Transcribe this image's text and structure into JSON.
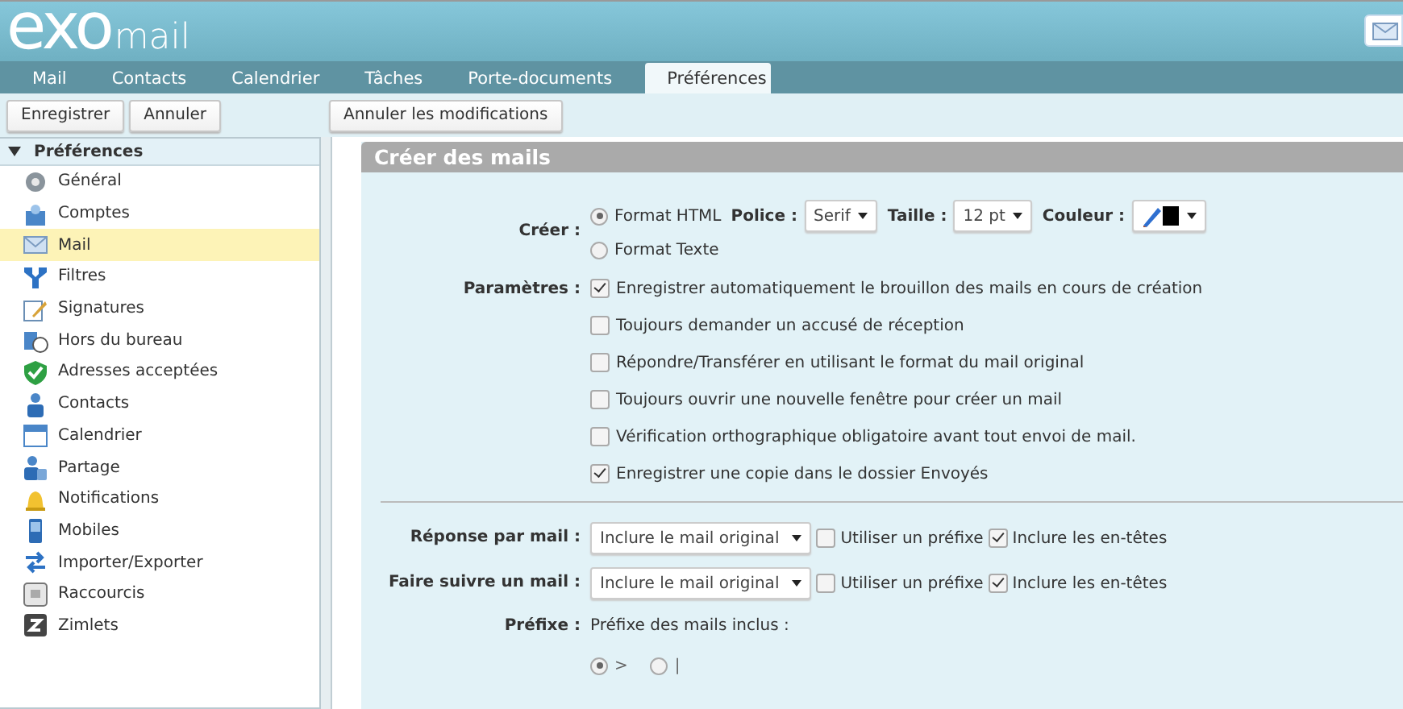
{
  "logo": {
    "brand": "exo",
    "product": "mail"
  },
  "tabs": [
    {
      "label": "Mail",
      "selected": false
    },
    {
      "label": "Contacts",
      "selected": false
    },
    {
      "label": "Calendrier",
      "selected": false
    },
    {
      "label": "Tâches",
      "selected": false
    },
    {
      "label": "Porte-documents",
      "selected": false
    },
    {
      "label": "Préférences",
      "selected": true
    }
  ],
  "toolbar": {
    "left": [
      "Enregistrer",
      "Annuler"
    ],
    "right": [
      "Annuler les modifications"
    ]
  },
  "sidebar": {
    "title": "Préférences",
    "expanded": true,
    "items": [
      {
        "label": "Général",
        "selected": false
      },
      {
        "label": "Comptes",
        "selected": false
      },
      {
        "label": "Mail",
        "selected": true
      },
      {
        "label": "Filtres",
        "selected": false
      },
      {
        "label": "Signatures",
        "selected": false
      },
      {
        "label": "Hors du bureau",
        "selected": false
      },
      {
        "label": "Adresses acceptées",
        "selected": false
      },
      {
        "label": "Contacts",
        "selected": false
      },
      {
        "label": "Calendrier",
        "selected": false
      },
      {
        "label": "Partage",
        "selected": false
      },
      {
        "label": "Notifications",
        "selected": false
      },
      {
        "label": "Mobiles",
        "selected": false
      },
      {
        "label": "Importer/Exporter",
        "selected": false
      },
      {
        "label": "Raccourcis",
        "selected": false
      },
      {
        "label": "Zimlets",
        "selected": false
      }
    ]
  },
  "section": {
    "title": "Créer des mails",
    "create": {
      "label": "Créer :",
      "formats": [
        {
          "label": "Format HTML",
          "selected": true
        },
        {
          "label": "Format Texte",
          "selected": false
        }
      ],
      "font": {
        "label": "Police :",
        "value": "Serif"
      },
      "size": {
        "label": "Taille :",
        "value": "12 pt"
      },
      "color": {
        "label": "Couleur :",
        "color": "#000000"
      }
    },
    "settings": {
      "label": "Paramètres :",
      "options": [
        {
          "label": "Enregistrer automatiquement le brouillon des mails en cours de création",
          "checked": true
        },
        {
          "label": "Toujours demander un accusé de réception",
          "checked": false
        },
        {
          "label": "Répondre/Transférer en utilisant le format du mail original",
          "checked": false
        },
        {
          "label": "Toujours ouvrir une nouvelle fenêtre pour créer un mail",
          "checked": false
        },
        {
          "label": "Vérification orthographique obligatoire avant tout envoi de mail.",
          "checked": false
        },
        {
          "label": "Enregistrer une copie dans le dossier Envoyés",
          "checked": true
        }
      ]
    },
    "forwarding": [
      {
        "label": "Réponse par mail :",
        "value": "Inclure le mail original",
        "prefix": {
          "label": "Utiliser un préfixe",
          "checked": false
        },
        "headers": {
          "label": "Inclure les en-têtes",
          "checked": true
        }
      },
      {
        "label": "Faire suivre un mail :",
        "value": "Inclure le mail original",
        "prefix": {
          "label": "Utiliser un préfixe",
          "checked": false
        },
        "headers": {
          "label": "Inclure les en-têtes",
          "checked": true
        }
      }
    ],
    "prefix": {
      "label": "Préfixe :",
      "text": "Préfixe des mails inclus :",
      "options": [
        {
          "label": ">",
          "selected": true
        },
        {
          "label": "|",
          "selected": false
        }
      ]
    }
  }
}
